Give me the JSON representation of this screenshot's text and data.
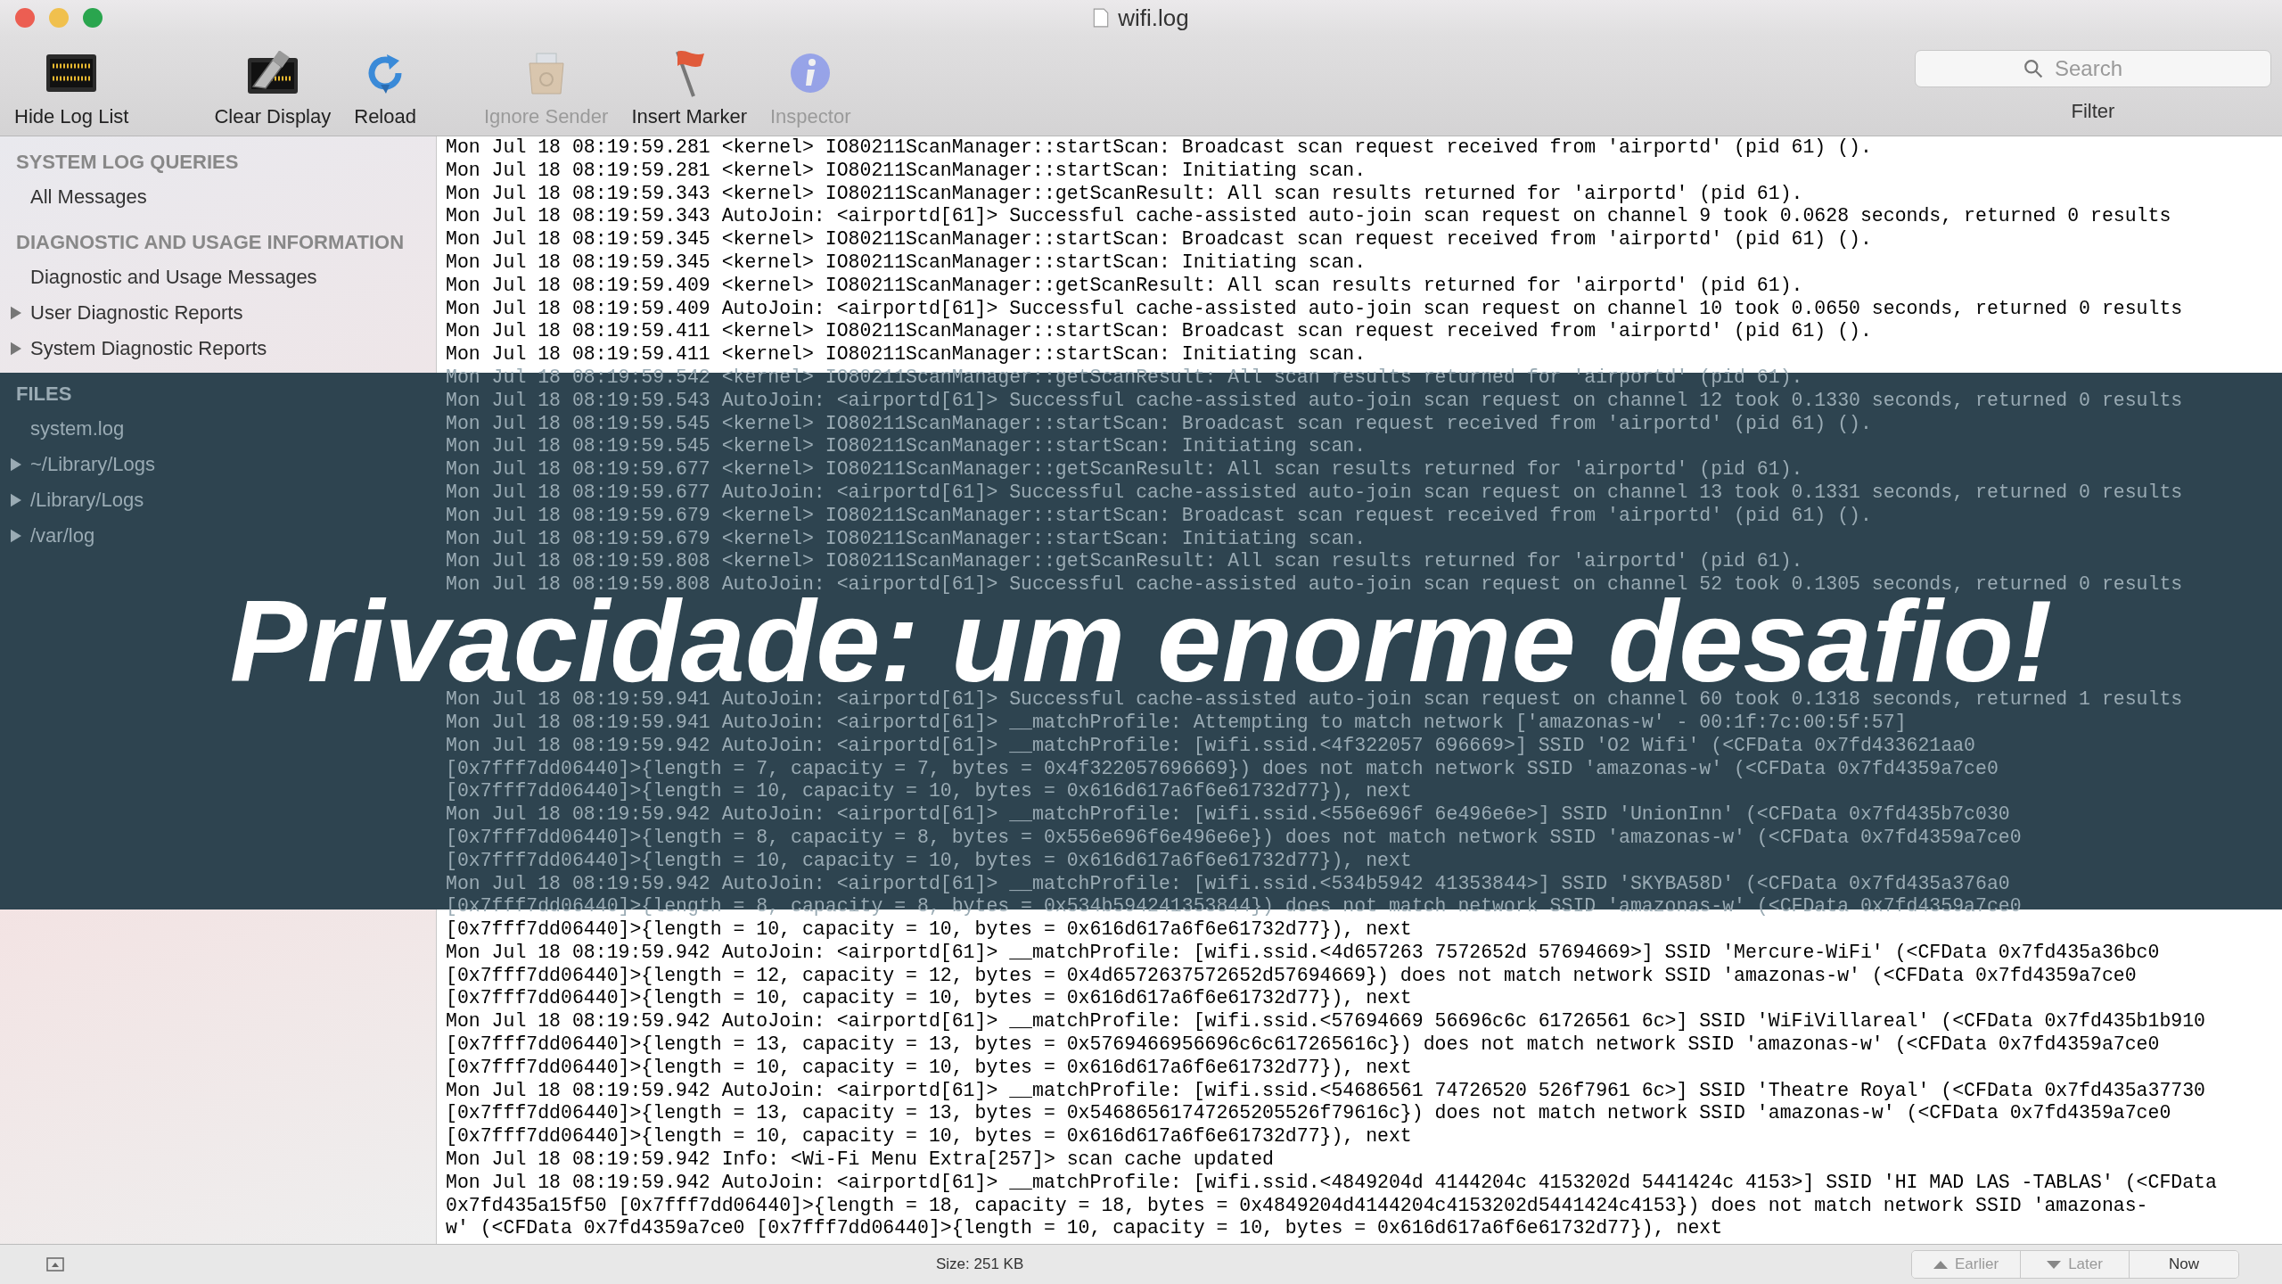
{
  "window": {
    "title": "wifi.log"
  },
  "toolbar": [
    {
      "label": "Hide Log List",
      "kind": "display",
      "disabled": false
    },
    {
      "label": "Clear Display",
      "kind": "wipe",
      "disabled": false
    },
    {
      "label": "Reload",
      "kind": "reload",
      "disabled": false
    },
    {
      "label": "Ignore Sender",
      "kind": "bag",
      "disabled": true
    },
    {
      "label": "Insert Marker",
      "kind": "flag",
      "disabled": false
    },
    {
      "label": "Inspector",
      "kind": "info",
      "disabled": true
    }
  ],
  "search": {
    "placeholder": "Search",
    "label": "Filter"
  },
  "sidebar": {
    "sections": [
      {
        "title": "SYSTEM LOG QUERIES",
        "items": [
          {
            "label": "All Messages",
            "kind": "leaf"
          }
        ]
      },
      {
        "title": "DIAGNOSTIC AND USAGE INFORMATION",
        "items": [
          {
            "label": "Diagnostic and Usage Messages",
            "kind": "leaf"
          },
          {
            "label": "User Diagnostic Reports",
            "kind": "folder"
          },
          {
            "label": "System Diagnostic Reports",
            "kind": "folder"
          }
        ]
      },
      {
        "title": "FILES",
        "items": [
          {
            "label": "system.log",
            "kind": "leaf"
          },
          {
            "label": "~/Library/Logs",
            "kind": "folder"
          },
          {
            "label": "/Library/Logs",
            "kind": "folder"
          },
          {
            "label": "/var/log",
            "kind": "folder"
          }
        ]
      }
    ]
  },
  "log": {
    "lines_above_title": [
      "Mon Jul 18 08:19:59.281 <kernel> IO80211ScanManager::startScan: Broadcast scan request received from 'airportd' (pid 61) ().",
      "Mon Jul 18 08:19:59.281 <kernel> IO80211ScanManager::startScan: Initiating scan.",
      "Mon Jul 18 08:19:59.343 <kernel> IO80211ScanManager::getScanResult: All scan results returned for 'airportd' (pid 61).",
      "Mon Jul 18 08:19:59.343 AutoJoin: <airportd[61]> Successful cache-assisted auto-join scan request on channel 9 took 0.0628 seconds, returned 0 results",
      "Mon Jul 18 08:19:59.345 <kernel> IO80211ScanManager::startScan: Broadcast scan request received from 'airportd' (pid 61) ().",
      "Mon Jul 18 08:19:59.345 <kernel> IO80211ScanManager::startScan: Initiating scan.",
      "Mon Jul 18 08:19:59.409 <kernel> IO80211ScanManager::getScanResult: All scan results returned for 'airportd' (pid 61).",
      "Mon Jul 18 08:19:59.409 AutoJoin: <airportd[61]> Successful cache-assisted auto-join scan request on channel 10 took 0.0650 seconds, returned 0 results",
      "Mon Jul 18 08:19:59.411 <kernel> IO80211ScanManager::startScan: Broadcast scan request received from 'airportd' (pid 61) ().",
      "Mon Jul 18 08:19:59.411 <kernel> IO80211ScanManager::startScan: Initiating scan.",
      "Mon Jul 18 08:19:59.542 <kernel> IO80211ScanManager::getScanResult: All scan results returned for 'airportd' (pid 61).",
      "Mon Jul 18 08:19:59.543 AutoJoin: <airportd[61]> Successful cache-assisted auto-join scan request on channel 12 took 0.1330 seconds, returned 0 results",
      "Mon Jul 18 08:19:59.545 <kernel> IO80211ScanManager::startScan: Broadcast scan request received from 'airportd' (pid 61) ().",
      "Mon Jul 18 08:19:59.545 <kernel> IO80211ScanManager::startScan: Initiating scan.",
      "Mon Jul 18 08:19:59.677 <kernel> IO80211ScanManager::getScanResult: All scan results returned for 'airportd' (pid 61).",
      "Mon Jul 18 08:19:59.677 AutoJoin: <airportd[61]> Successful cache-assisted auto-join scan request on channel 13 took 0.1331 seconds, returned 0 results",
      "Mon Jul 18 08:19:59.679 <kernel> IO80211ScanManager::startScan: Broadcast scan request received from 'airportd' (pid 61) ().",
      "Mon Jul 18 08:19:59.679 <kernel> IO80211ScanManager::startScan: Initiating scan.",
      "Mon Jul 18 08:19:59.808 <kernel> IO80211ScanManager::getScanResult: All scan results returned for 'airportd' (pid 61).",
      "Mon Jul 18 08:19:59.808 AutoJoin: <airportd[61]> Successful cache-assisted auto-join scan request on channel 52 took 0.1305 seconds, returned 0 results"
    ],
    "lines_below_title": [
      "Mon Jul 18 08:19:59.941 AutoJoin: <airportd[61]> Successful cache-assisted auto-join scan request on channel 60 took 0.1318 seconds, returned 1 results",
      "Mon Jul 18 08:19:59.941 AutoJoin: <airportd[61]> __matchProfile: Attempting to match network ['amazonas-w' - 00:1f:7c:00:5f:57]",
      "Mon Jul 18 08:19:59.942 AutoJoin: <airportd[61]> __matchProfile: [wifi.ssid.<4f322057 696669>] SSID 'O2 Wifi' (<CFData 0x7fd433621aa0",
      "[0x7fff7dd06440]>{length = 7, capacity = 7, bytes = 0x4f322057696669}) does not match network SSID 'amazonas-w' (<CFData 0x7fd4359a7ce0",
      "[0x7fff7dd06440]>{length = 10, capacity = 10, bytes = 0x616d617a6f6e61732d77}), next",
      "Mon Jul 18 08:19:59.942 AutoJoin: <airportd[61]> __matchProfile: [wifi.ssid.<556e696f 6e496e6e>] SSID 'UnionInn' (<CFData 0x7fd435b7c030",
      "[0x7fff7dd06440]>{length = 8, capacity = 8, bytes = 0x556e696f6e496e6e}) does not match network SSID 'amazonas-w' (<CFData 0x7fd4359a7ce0",
      "[0x7fff7dd06440]>{length = 10, capacity = 10, bytes = 0x616d617a6f6e61732d77}), next",
      "Mon Jul 18 08:19:59.942 AutoJoin: <airportd[61]> __matchProfile: [wifi.ssid.<534b5942 41353844>] SSID 'SKYBA58D' (<CFData 0x7fd435a376a0",
      "[0x7fff7dd06440]>{length = 8, capacity = 8, bytes = 0x534b594241353844}) does not match network SSID 'amazonas-w' (<CFData 0x7fd4359a7ce0",
      "[0x7fff7dd06440]>{length = 10, capacity = 10, bytes = 0x616d617a6f6e61732d77}), next",
      "Mon Jul 18 08:19:59.942 AutoJoin: <airportd[61]> __matchProfile: [wifi.ssid.<4d657263 7572652d 57694669>] SSID 'Mercure-WiFi' (<CFData 0x7fd435a36bc0",
      "[0x7fff7dd06440]>{length = 12, capacity = 12, bytes = 0x4d6572637572652d57694669}) does not match network SSID 'amazonas-w' (<CFData 0x7fd4359a7ce0",
      "[0x7fff7dd06440]>{length = 10, capacity = 10, bytes = 0x616d617a6f6e61732d77}), next",
      "Mon Jul 18 08:19:59.942 AutoJoin: <airportd[61]> __matchProfile: [wifi.ssid.<57694669 56696c6c 61726561 6c>] SSID 'WiFiVillareal' (<CFData 0x7fd435b1b910",
      "[0x7fff7dd06440]>{length = 13, capacity = 13, bytes = 0x5769466956696c6c617265616c}) does not match network SSID 'amazonas-w' (<CFData 0x7fd4359a7ce0",
      "[0x7fff7dd06440]>{length = 10, capacity = 10, bytes = 0x616d617a6f6e61732d77}), next",
      "Mon Jul 18 08:19:59.942 AutoJoin: <airportd[61]> __matchProfile: [wifi.ssid.<54686561 74726520 526f7961 6c>] SSID 'Theatre Royal' (<CFData 0x7fd435a37730",
      "[0x7fff7dd06440]>{length = 13, capacity = 13, bytes = 0x54686561747265205526f79616c}) does not match network SSID 'amazonas-w' (<CFData 0x7fd4359a7ce0",
      "[0x7fff7dd06440]>{length = 10, capacity = 10, bytes = 0x616d617a6f6e61732d77}), next",
      "Mon Jul 18 08:19:59.942 Info: <Wi-Fi Menu Extra[257]> scan cache updated",
      "Mon Jul 18 08:19:59.942 AutoJoin: <airportd[61]> __matchProfile: [wifi.ssid.<4849204d 4144204c 4153202d 5441424c 4153>] SSID 'HI MAD LAS -TABLAS' (<CFData",
      "0x7fd435a15f50 [0x7fff7dd06440]>{length = 18, capacity = 18, bytes = 0x4849204d4144204c4153202d5441424c4153}) does not match network SSID 'amazonas-",
      "w' (<CFData 0x7fd4359a7ce0 [0x7fff7dd06440]>{length = 10, capacity = 10, bytes = 0x616d617a6f6e61732d77}), next"
    ]
  },
  "status_bar": {
    "size": "Size: 251 KB",
    "nav": [
      {
        "label": "Earlier",
        "kind": "up"
      },
      {
        "label": "Later",
        "kind": "down"
      },
      {
        "label": "Now",
        "kind": "plain"
      }
    ]
  },
  "overlay": {
    "title": "Privacidade: um enorme desafio!"
  }
}
